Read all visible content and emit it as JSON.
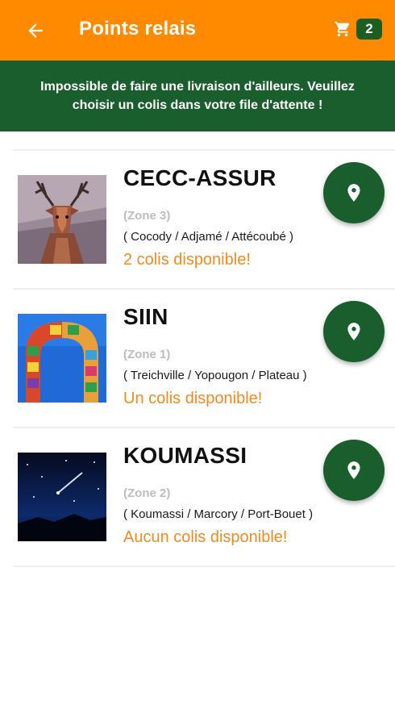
{
  "appbar": {
    "title": "Points relais",
    "back_icon": "arrow-left-icon",
    "cart_icon": "cart-icon",
    "cart_count": "2",
    "background": "#ff8a00"
  },
  "banner": {
    "text": "Impossible de faire une livraison d'ailleurs. Veuillez choisir un colis dans votre file d'attente !",
    "background": "#1b5e2e"
  },
  "relay_points": [
    {
      "name": "CECC-ASSUR",
      "zone": "(Zone 3)",
      "communes": "( Cocody / Adjamé / Attécoubé )",
      "availability": "2 colis disponible!",
      "image": "deer-thumbnail",
      "action_icon": "map-pin-icon"
    },
    {
      "name": "SIIN",
      "zone": "(Zone 1)",
      "communes": "( Treichville / Yopougon / Plateau )",
      "availability": "Un colis disponible!",
      "image": "colorful-arch-thumbnail",
      "action_icon": "map-pin-icon"
    },
    {
      "name": "KOUMASSI",
      "zone": "(Zone 2)",
      "communes": "( Koumassi / Marcory / Port-Bouet )",
      "availability": "Aucun colis disponible!",
      "image": "night-sky-thumbnail",
      "action_icon": "map-pin-icon"
    }
  ],
  "colors": {
    "accent_orange": "#f58a1f",
    "brand_green": "#1b5e2e",
    "zone_gray": "#bdbdbd"
  }
}
